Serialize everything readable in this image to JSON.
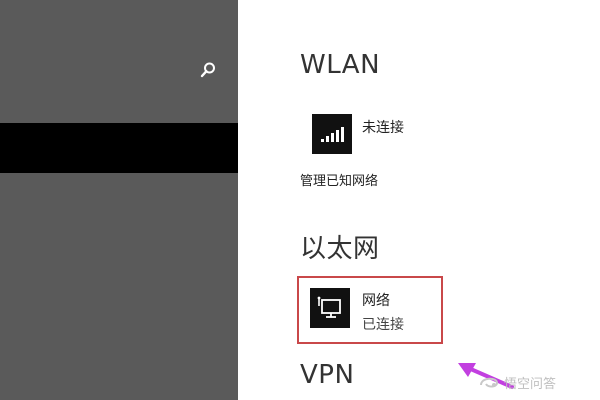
{
  "sections": {
    "wlan": {
      "title": "WLAN",
      "network_status": "未连接",
      "manage_link": "管理已知网络"
    },
    "ethernet": {
      "title": "以太网",
      "network_name": "网络",
      "network_status": "已连接"
    },
    "vpn": {
      "title": "VPN"
    }
  },
  "icons": {
    "search": "search-icon",
    "wifi": "wifi-signal-icon",
    "ethernet": "ethernet-monitor-icon",
    "arrow": "pointer-arrow"
  },
  "colors": {
    "left_pane": "#5a5a5a",
    "selected": "#000000",
    "highlight": "#c9484a",
    "arrow": "#c23fe0"
  },
  "watermark": {
    "text": "悟空问答"
  }
}
